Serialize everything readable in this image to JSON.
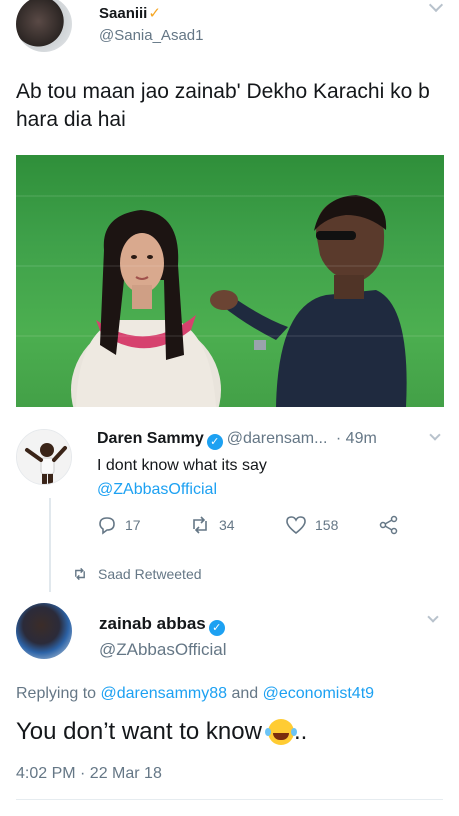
{
  "original_tweet": {
    "display_name": "Saaniii",
    "name_mark": "✓",
    "handle": "@Sania_Asad1",
    "text": "Ab tou maan jao zainab' Dekho Karachi ko b hara dia hai"
  },
  "quoted_tweet": {
    "display_name": "Daren Sammy",
    "handle": "@darensam...",
    "time": "· 49m",
    "text_line1": "I dont know what its say",
    "mention": "@ZAbbasOfficial",
    "reply_count": "17",
    "retweet_count": "34",
    "like_count": "158"
  },
  "retweet_banner": {
    "text": "Saad Retweeted"
  },
  "reply_tweet": {
    "display_name": "zainab abbas",
    "handle": "@ZAbbasOfficial",
    "replying_prefix": "Replying to",
    "reply_to_1": "@darensammy88",
    "replying_and": "and",
    "reply_to_2": "@economist4t9",
    "text": "You don’t want to know",
    "text_suffix": "..",
    "timestamp": "4:02 PM · 22 Mar 18"
  },
  "colors": {
    "accent": "#1da1f2",
    "muted": "#657786",
    "text": "#14171a",
    "pitch": "#43a047"
  },
  "icons": [
    "chevron-down-icon",
    "verified-badge-icon",
    "reply-icon",
    "retweet-icon",
    "like-icon",
    "share-icon",
    "laughing-emoji-icon"
  ]
}
